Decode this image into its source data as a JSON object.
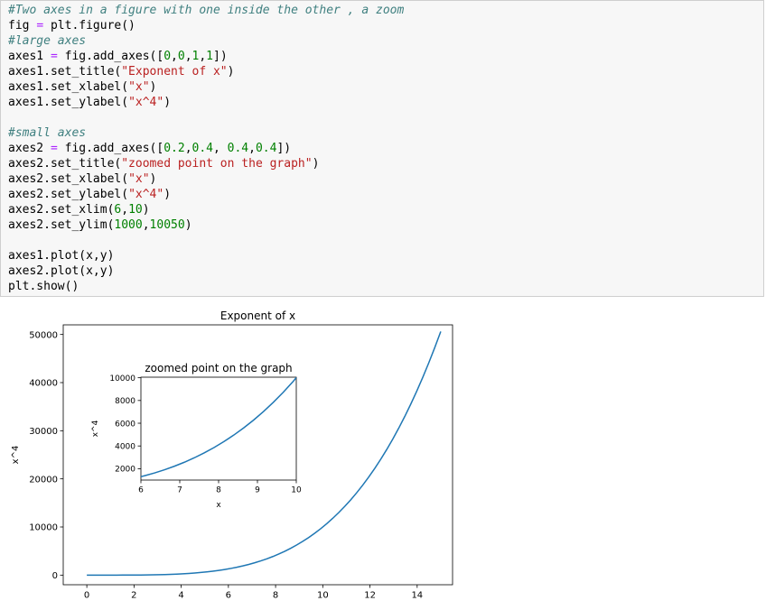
{
  "code_cell": {
    "lines": [
      [
        {
          "t": "#Two axes in a figure with one inside the other , a zoom",
          "k": "comment"
        }
      ],
      [
        {
          "t": "fig ",
          "k": ""
        },
        {
          "t": "=",
          "k": "op"
        },
        {
          "t": " plt.figure()",
          "k": ""
        }
      ],
      [
        {
          "t": "#large axes",
          "k": "comment"
        }
      ],
      [
        {
          "t": "axes1 ",
          "k": ""
        },
        {
          "t": "=",
          "k": "op"
        },
        {
          "t": " fig.add_axes([",
          "k": ""
        },
        {
          "t": "0",
          "k": "num"
        },
        {
          "t": ",",
          "k": ""
        },
        {
          "t": "0",
          "k": "num"
        },
        {
          "t": ",",
          "k": ""
        },
        {
          "t": "1",
          "k": "num"
        },
        {
          "t": ",",
          "k": ""
        },
        {
          "t": "1",
          "k": "num"
        },
        {
          "t": "])",
          "k": ""
        }
      ],
      [
        {
          "t": "axes1.set_title(",
          "k": ""
        },
        {
          "t": "\"Exponent of x\"",
          "k": "str"
        },
        {
          "t": ")",
          "k": ""
        }
      ],
      [
        {
          "t": "axes1.set_xlabel(",
          "k": ""
        },
        {
          "t": "\"x\"",
          "k": "str"
        },
        {
          "t": ")",
          "k": ""
        }
      ],
      [
        {
          "t": "axes1.set_ylabel(",
          "k": ""
        },
        {
          "t": "\"x^4\"",
          "k": "str"
        },
        {
          "t": ")",
          "k": ""
        }
      ],
      [],
      [
        {
          "t": "#small axes",
          "k": "comment"
        }
      ],
      [
        {
          "t": "axes2 ",
          "k": ""
        },
        {
          "t": "=",
          "k": "op"
        },
        {
          "t": " fig.add_axes([",
          "k": ""
        },
        {
          "t": "0.2",
          "k": "num"
        },
        {
          "t": ",",
          "k": ""
        },
        {
          "t": "0.4",
          "k": "num"
        },
        {
          "t": ", ",
          "k": ""
        },
        {
          "t": "0.4",
          "k": "num"
        },
        {
          "t": ",",
          "k": ""
        },
        {
          "t": "0.4",
          "k": "num"
        },
        {
          "t": "])",
          "k": ""
        }
      ],
      [
        {
          "t": "axes2.set_title(",
          "k": ""
        },
        {
          "t": "\"zoomed point on the graph\"",
          "k": "str"
        },
        {
          "t": ")",
          "k": ""
        }
      ],
      [
        {
          "t": "axes2.set_xlabel(",
          "k": ""
        },
        {
          "t": "\"x\"",
          "k": "str"
        },
        {
          "t": ")",
          "k": ""
        }
      ],
      [
        {
          "t": "axes2.set_ylabel(",
          "k": ""
        },
        {
          "t": "\"x^4\"",
          "k": "str"
        },
        {
          "t": ")",
          "k": ""
        }
      ],
      [
        {
          "t": "axes2.set_xlim(",
          "k": ""
        },
        {
          "t": "6",
          "k": "num"
        },
        {
          "t": ",",
          "k": ""
        },
        {
          "t": "10",
          "k": "num"
        },
        {
          "t": ")",
          "k": ""
        }
      ],
      [
        {
          "t": "axes2.set_ylim(",
          "k": ""
        },
        {
          "t": "1000",
          "k": "num"
        },
        {
          "t": ",",
          "k": ""
        },
        {
          "t": "10050",
          "k": "num"
        },
        {
          "t": ")",
          "k": ""
        }
      ],
      [],
      [
        {
          "t": "axes1.plot(x,y)",
          "k": ""
        }
      ],
      [
        {
          "t": "axes2.plot(x,y)",
          "k": ""
        }
      ],
      [
        {
          "t": "plt.show()",
          "k": ""
        }
      ]
    ]
  },
  "chart_data": [
    {
      "type": "line",
      "title": "Exponent of x",
      "xlabel": "x",
      "ylabel": "x^4",
      "xlim": [
        -1,
        15.5
      ],
      "ylim": [
        -2000,
        52000
      ],
      "xticks": [
        0,
        2,
        4,
        6,
        8,
        10,
        12,
        14
      ],
      "yticks": [
        0,
        10000,
        20000,
        30000,
        40000,
        50000
      ],
      "grid": false,
      "color": "#1f77b4",
      "function": "x^4",
      "x_range": [
        0,
        15
      ],
      "samples": 60
    },
    {
      "type": "line",
      "title": "zoomed point on the graph",
      "xlabel": "x",
      "ylabel": "x^4",
      "xlim": [
        6,
        10
      ],
      "ylim": [
        1000,
        10050
      ],
      "xticks": [
        6,
        7,
        8,
        9,
        10
      ],
      "yticks": [
        2000,
        4000,
        6000,
        8000,
        10000
      ],
      "grid": false,
      "color": "#1f77b4",
      "function": "x^4",
      "x_range": [
        0,
        15
      ],
      "samples": 60
    }
  ]
}
